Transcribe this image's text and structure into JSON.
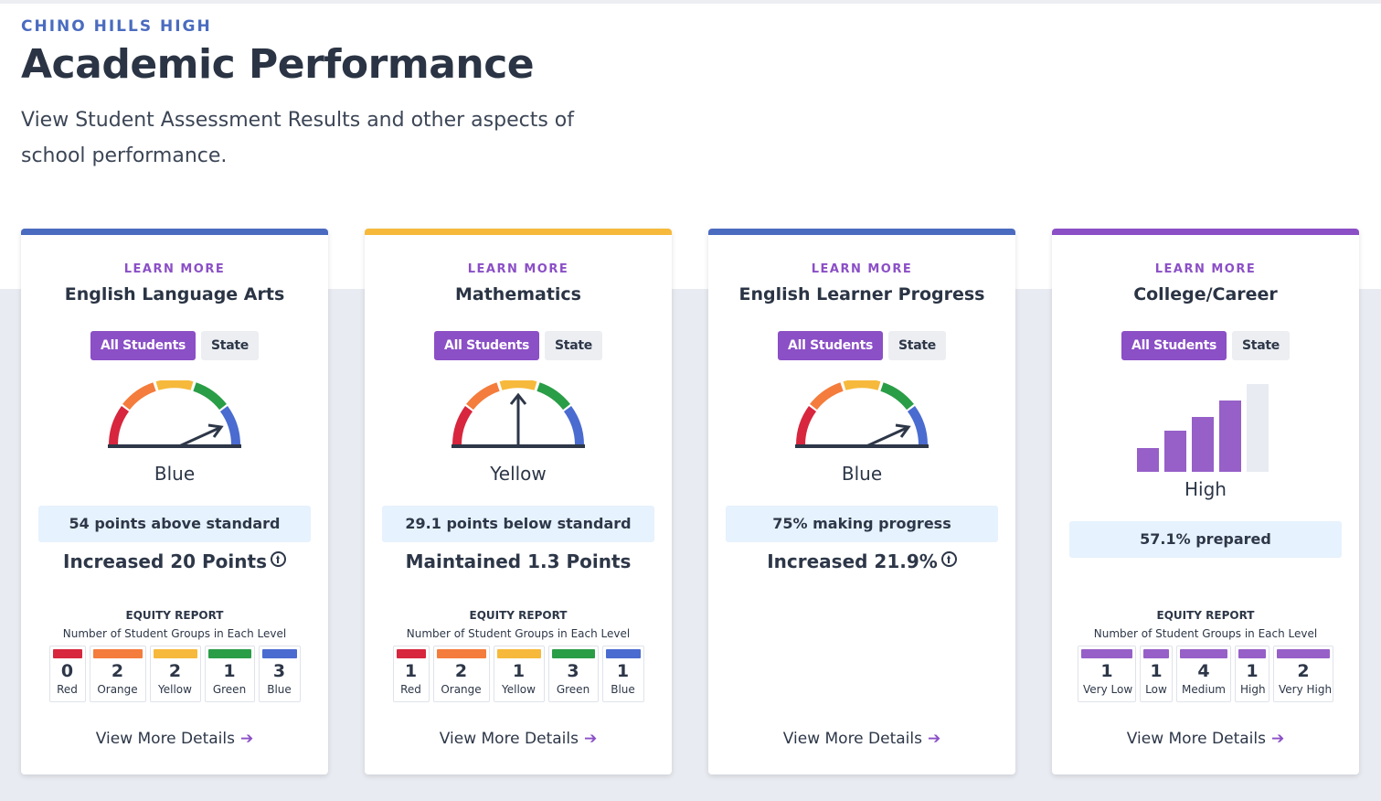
{
  "header": {
    "school": "CHINO HILLS HIGH",
    "title": "Academic Performance",
    "subtitle": "View Student Assessment Results and other aspects of school performance."
  },
  "colors": {
    "ela_accent": "#4a6bbf",
    "math_accent": "#f6b93b",
    "elp_accent": "#4a6bbf",
    "cc_accent": "#8b4fc6",
    "red": "#d7263d",
    "orange": "#f47c3c",
    "yellow": "#f6b93b",
    "green": "#2a9d47",
    "blue": "#4a6bd0",
    "purple": "#9660c8"
  },
  "cards": [
    {
      "learn_more": "LEARN MORE",
      "title": "English Language Arts",
      "toggle": {
        "all": "All Students",
        "state": "State"
      },
      "level": "Blue",
      "stat": "54 points above standard",
      "change": "Increased 20 Points",
      "equity_title": "EQUITY REPORT",
      "equity_sub": "Number of Student Groups in Each Level",
      "equity": [
        {
          "num": "0",
          "label": "Red",
          "color": "#d7263d"
        },
        {
          "num": "2",
          "label": "Orange",
          "color": "#f47c3c"
        },
        {
          "num": "2",
          "label": "Yellow",
          "color": "#f6b93b"
        },
        {
          "num": "1",
          "label": "Green",
          "color": "#2a9d47"
        },
        {
          "num": "3",
          "label": "Blue",
          "color": "#4a6bd0"
        }
      ],
      "details": "View More Details"
    },
    {
      "learn_more": "LEARN MORE",
      "title": "Mathematics",
      "toggle": {
        "all": "All Students",
        "state": "State"
      },
      "level": "Yellow",
      "stat": "29.1 points below standard",
      "change": "Maintained 1.3 Points",
      "equity_title": "EQUITY REPORT",
      "equity_sub": "Number of Student Groups in Each Level",
      "equity": [
        {
          "num": "1",
          "label": "Red",
          "color": "#d7263d"
        },
        {
          "num": "2",
          "label": "Orange",
          "color": "#f47c3c"
        },
        {
          "num": "1",
          "label": "Yellow",
          "color": "#f6b93b"
        },
        {
          "num": "3",
          "label": "Green",
          "color": "#2a9d47"
        },
        {
          "num": "1",
          "label": "Blue",
          "color": "#4a6bd0"
        }
      ],
      "details": "View More Details"
    },
    {
      "learn_more": "LEARN MORE",
      "title": "English Learner Progress",
      "toggle": {
        "all": "All Students",
        "state": "State"
      },
      "level": "Blue",
      "stat": "75% making progress",
      "change": "Increased 21.9%",
      "details": "View More Details"
    },
    {
      "learn_more": "LEARN MORE",
      "title": "College/Career",
      "toggle": {
        "all": "All Students",
        "state": "State"
      },
      "level": "High",
      "stat": "57.1% prepared",
      "equity_title": "EQUITY REPORT",
      "equity_sub": "Number of Student Groups in Each Level",
      "equity": [
        {
          "num": "1",
          "label": "Very Low",
          "color": "#9660c8"
        },
        {
          "num": "1",
          "label": "Low",
          "color": "#9660c8"
        },
        {
          "num": "4",
          "label": "Medium",
          "color": "#9660c8"
        },
        {
          "num": "1",
          "label": "High",
          "color": "#9660c8"
        },
        {
          "num": "2",
          "label": "Very High",
          "color": "#9660c8"
        }
      ],
      "details": "View More Details"
    }
  ]
}
